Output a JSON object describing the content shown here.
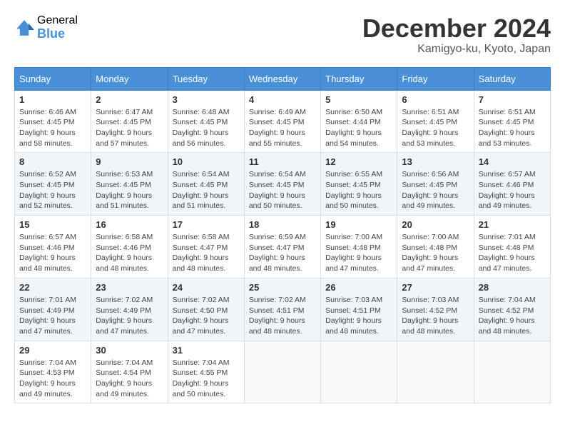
{
  "header": {
    "logo_general": "General",
    "logo_blue": "Blue",
    "month_title": "December 2024",
    "location": "Kamigyo-ku, Kyoto, Japan"
  },
  "days_of_week": [
    "Sunday",
    "Monday",
    "Tuesday",
    "Wednesday",
    "Thursday",
    "Friday",
    "Saturday"
  ],
  "weeks": [
    [
      {
        "day": "1",
        "sunrise": "Sunrise: 6:46 AM",
        "sunset": "Sunset: 4:45 PM",
        "daylight": "Daylight: 9 hours and 58 minutes."
      },
      {
        "day": "2",
        "sunrise": "Sunrise: 6:47 AM",
        "sunset": "Sunset: 4:45 PM",
        "daylight": "Daylight: 9 hours and 57 minutes."
      },
      {
        "day": "3",
        "sunrise": "Sunrise: 6:48 AM",
        "sunset": "Sunset: 4:45 PM",
        "daylight": "Daylight: 9 hours and 56 minutes."
      },
      {
        "day": "4",
        "sunrise": "Sunrise: 6:49 AM",
        "sunset": "Sunset: 4:45 PM",
        "daylight": "Daylight: 9 hours and 55 minutes."
      },
      {
        "day": "5",
        "sunrise": "Sunrise: 6:50 AM",
        "sunset": "Sunset: 4:44 PM",
        "daylight": "Daylight: 9 hours and 54 minutes."
      },
      {
        "day": "6",
        "sunrise": "Sunrise: 6:51 AM",
        "sunset": "Sunset: 4:45 PM",
        "daylight": "Daylight: 9 hours and 53 minutes."
      },
      {
        "day": "7",
        "sunrise": "Sunrise: 6:51 AM",
        "sunset": "Sunset: 4:45 PM",
        "daylight": "Daylight: 9 hours and 53 minutes."
      }
    ],
    [
      {
        "day": "8",
        "sunrise": "Sunrise: 6:52 AM",
        "sunset": "Sunset: 4:45 PM",
        "daylight": "Daylight: 9 hours and 52 minutes."
      },
      {
        "day": "9",
        "sunrise": "Sunrise: 6:53 AM",
        "sunset": "Sunset: 4:45 PM",
        "daylight": "Daylight: 9 hours and 51 minutes."
      },
      {
        "day": "10",
        "sunrise": "Sunrise: 6:54 AM",
        "sunset": "Sunset: 4:45 PM",
        "daylight": "Daylight: 9 hours and 51 minutes."
      },
      {
        "day": "11",
        "sunrise": "Sunrise: 6:54 AM",
        "sunset": "Sunset: 4:45 PM",
        "daylight": "Daylight: 9 hours and 50 minutes."
      },
      {
        "day": "12",
        "sunrise": "Sunrise: 6:55 AM",
        "sunset": "Sunset: 4:45 PM",
        "daylight": "Daylight: 9 hours and 50 minutes."
      },
      {
        "day": "13",
        "sunrise": "Sunrise: 6:56 AM",
        "sunset": "Sunset: 4:45 PM",
        "daylight": "Daylight: 9 hours and 49 minutes."
      },
      {
        "day": "14",
        "sunrise": "Sunrise: 6:57 AM",
        "sunset": "Sunset: 4:46 PM",
        "daylight": "Daylight: 9 hours and 49 minutes."
      }
    ],
    [
      {
        "day": "15",
        "sunrise": "Sunrise: 6:57 AM",
        "sunset": "Sunset: 4:46 PM",
        "daylight": "Daylight: 9 hours and 48 minutes."
      },
      {
        "day": "16",
        "sunrise": "Sunrise: 6:58 AM",
        "sunset": "Sunset: 4:46 PM",
        "daylight": "Daylight: 9 hours and 48 minutes."
      },
      {
        "day": "17",
        "sunrise": "Sunrise: 6:58 AM",
        "sunset": "Sunset: 4:47 PM",
        "daylight": "Daylight: 9 hours and 48 minutes."
      },
      {
        "day": "18",
        "sunrise": "Sunrise: 6:59 AM",
        "sunset": "Sunset: 4:47 PM",
        "daylight": "Daylight: 9 hours and 48 minutes."
      },
      {
        "day": "19",
        "sunrise": "Sunrise: 7:00 AM",
        "sunset": "Sunset: 4:48 PM",
        "daylight": "Daylight: 9 hours and 47 minutes."
      },
      {
        "day": "20",
        "sunrise": "Sunrise: 7:00 AM",
        "sunset": "Sunset: 4:48 PM",
        "daylight": "Daylight: 9 hours and 47 minutes."
      },
      {
        "day": "21",
        "sunrise": "Sunrise: 7:01 AM",
        "sunset": "Sunset: 4:48 PM",
        "daylight": "Daylight: 9 hours and 47 minutes."
      }
    ],
    [
      {
        "day": "22",
        "sunrise": "Sunrise: 7:01 AM",
        "sunset": "Sunset: 4:49 PM",
        "daylight": "Daylight: 9 hours and 47 minutes."
      },
      {
        "day": "23",
        "sunrise": "Sunrise: 7:02 AM",
        "sunset": "Sunset: 4:49 PM",
        "daylight": "Daylight: 9 hours and 47 minutes."
      },
      {
        "day": "24",
        "sunrise": "Sunrise: 7:02 AM",
        "sunset": "Sunset: 4:50 PM",
        "daylight": "Daylight: 9 hours and 47 minutes."
      },
      {
        "day": "25",
        "sunrise": "Sunrise: 7:02 AM",
        "sunset": "Sunset: 4:51 PM",
        "daylight": "Daylight: 9 hours and 48 minutes."
      },
      {
        "day": "26",
        "sunrise": "Sunrise: 7:03 AM",
        "sunset": "Sunset: 4:51 PM",
        "daylight": "Daylight: 9 hours and 48 minutes."
      },
      {
        "day": "27",
        "sunrise": "Sunrise: 7:03 AM",
        "sunset": "Sunset: 4:52 PM",
        "daylight": "Daylight: 9 hours and 48 minutes."
      },
      {
        "day": "28",
        "sunrise": "Sunrise: 7:04 AM",
        "sunset": "Sunset: 4:52 PM",
        "daylight": "Daylight: 9 hours and 48 minutes."
      }
    ],
    [
      {
        "day": "29",
        "sunrise": "Sunrise: 7:04 AM",
        "sunset": "Sunset: 4:53 PM",
        "daylight": "Daylight: 9 hours and 49 minutes."
      },
      {
        "day": "30",
        "sunrise": "Sunrise: 7:04 AM",
        "sunset": "Sunset: 4:54 PM",
        "daylight": "Daylight: 9 hours and 49 minutes."
      },
      {
        "day": "31",
        "sunrise": "Sunrise: 7:04 AM",
        "sunset": "Sunset: 4:55 PM",
        "daylight": "Daylight: 9 hours and 50 minutes."
      },
      null,
      null,
      null,
      null
    ]
  ]
}
